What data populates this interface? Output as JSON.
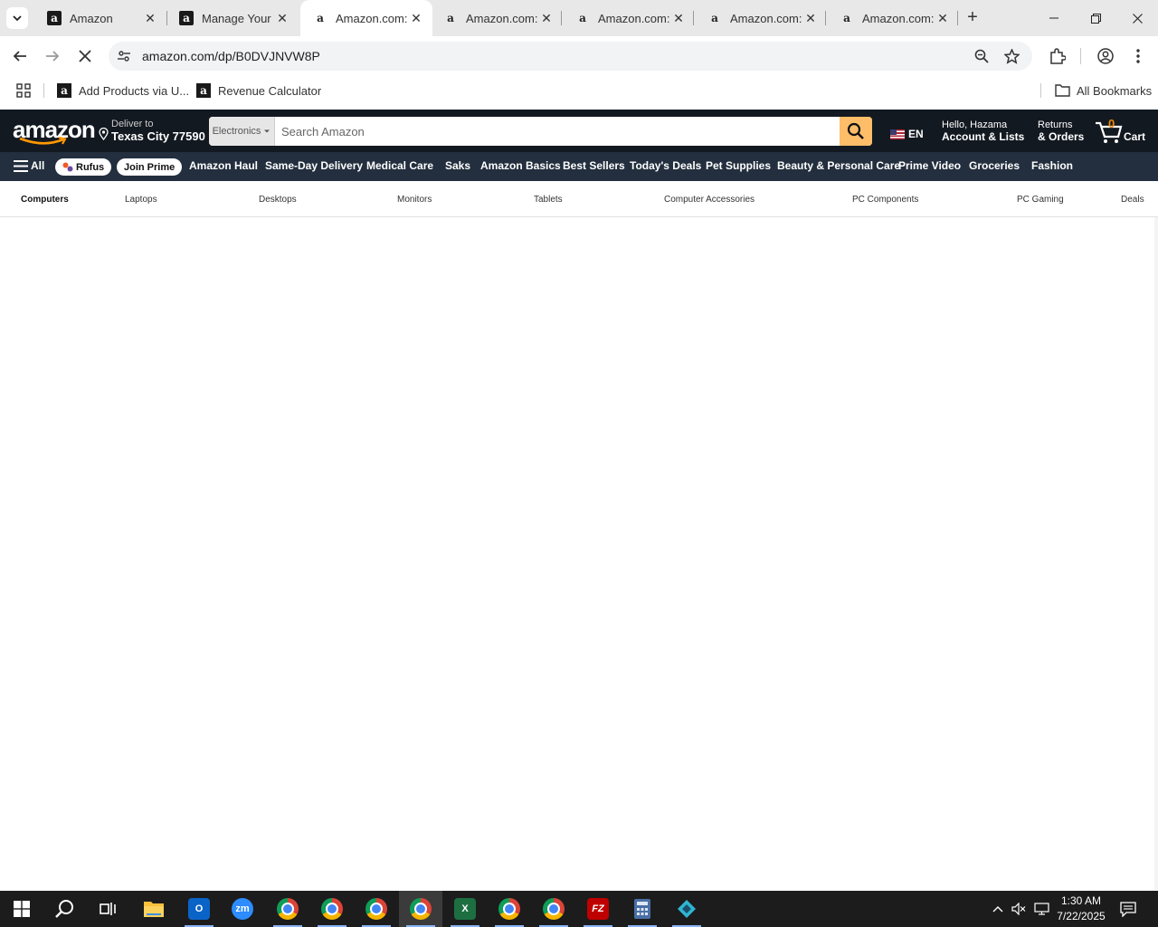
{
  "browser": {
    "tabs": [
      {
        "title": "Amazon",
        "favicon": "a",
        "active": false
      },
      {
        "title": "Manage Your",
        "favicon": "a",
        "active": false
      },
      {
        "title": "Amazon.com:",
        "favicon": "a",
        "active": true
      },
      {
        "title": "Amazon.com:",
        "favicon": "a",
        "active": false
      },
      {
        "title": "Amazon.com:",
        "favicon": "a",
        "active": false
      },
      {
        "title": "Amazon.com:",
        "favicon": "a",
        "active": false
      },
      {
        "title": "Amazon.com:",
        "favicon": "a",
        "active": false
      }
    ],
    "url": "amazon.com/dp/B0DVJNVW8P",
    "bookmarks": [
      {
        "label": "Add Products via U..."
      },
      {
        "label": "Revenue Calculator"
      }
    ],
    "all_bookmarks": "All Bookmarks"
  },
  "amazon": {
    "logo": "amazon",
    "deliver_line1": "Deliver to",
    "deliver_line2": "Texas City 77590",
    "search_category": "Electronics",
    "search_placeholder": "Search Amazon",
    "language": "EN",
    "account_line1": "Hello, Hazama",
    "account_line2": "Account & Lists",
    "returns_line1": "Returns",
    "returns_line2": "& Orders",
    "cart_count": "0",
    "cart_label": "Cart",
    "subnav": {
      "all": "All",
      "rufus": "Rufus",
      "join_prime": "Join Prime",
      "items": [
        "Amazon Haul",
        "Same-Day Delivery",
        "Medical Care",
        "Saks",
        "Amazon Basics",
        "Best Sellers",
        "Today's Deals",
        "Pet Supplies",
        "Beauty & Personal Care",
        "Prime Video",
        "Groceries",
        "Fashion"
      ]
    },
    "category_nav": [
      "Computers",
      "Laptops",
      "Desktops",
      "Monitors",
      "Tablets",
      "Computer Accessories",
      "PC Components",
      "PC Gaming",
      "Deals"
    ]
  },
  "taskbar": {
    "time": "1:30 AM",
    "date": "7/22/2025"
  },
  "colors": {
    "amazon_dark": "#131921",
    "amazon_subnav": "#232f3e",
    "search_button": "#febd69",
    "cart_count": "#f08804"
  }
}
